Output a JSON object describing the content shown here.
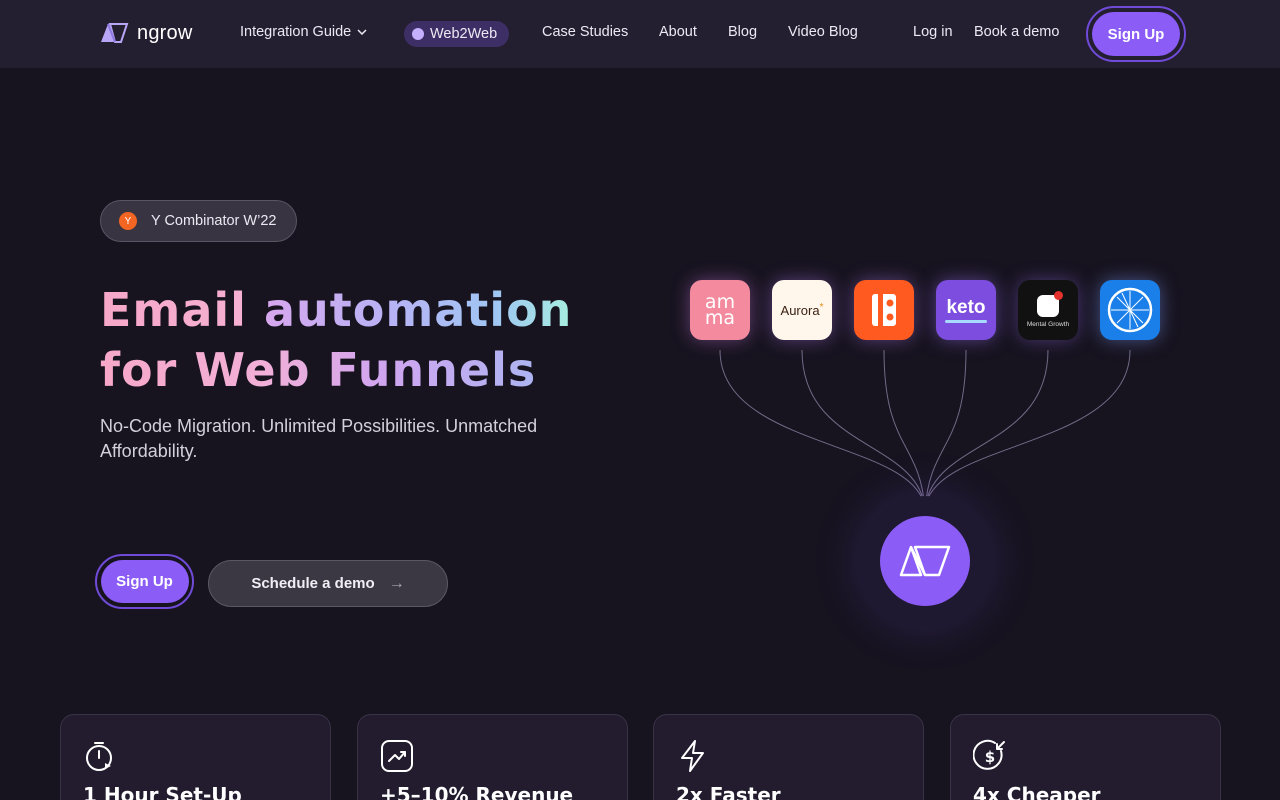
{
  "header": {
    "logo_text": "ngrow",
    "nav": [
      {
        "label": "Integration Guide"
      },
      {
        "label": "Web2Web"
      },
      {
        "label": "Case Studies"
      },
      {
        "label": "About"
      },
      {
        "label": "Blog"
      },
      {
        "label": "Video Blog"
      }
    ],
    "login_label": "Log in",
    "book_demo_label": "Book a demo",
    "signup_label": "Sign Up"
  },
  "hero": {
    "badge_icon_letter": "Y",
    "badge_text": "Y Combinator W’22",
    "title_line1_word1": "Email",
    "title_line1_word2": "automation",
    "title_line2": "for Web Funnels",
    "subtitle": "No-Code Migration. Unlimited Possibilities. Unmatched Affordability.",
    "signup_label": "Sign Up",
    "demo_label": "Schedule a demo"
  },
  "integrations": [
    {
      "name": "amma",
      "text": "am ma",
      "color": "#f38a9e"
    },
    {
      "name": "Aurora",
      "text": "Aurora",
      "color": "#fff7ec"
    },
    {
      "name": "B",
      "text": "",
      "color": "#ff5a1f"
    },
    {
      "name": "keto",
      "text": "keto",
      "color": "#7c4ddf"
    },
    {
      "name": "Mental Growth",
      "text": "Mental Growth",
      "color": "#111111"
    },
    {
      "name": "compass-app",
      "text": "",
      "color": "#1a7fe8"
    }
  ],
  "features": [
    {
      "icon": "timer-icon",
      "title": "1 Hour Set-Up"
    },
    {
      "icon": "trend-up-icon",
      "title": "+5–10% Revenue"
    },
    {
      "icon": "lightning-icon",
      "title": "2x Faster"
    },
    {
      "icon": "dollar-down-icon",
      "title": "4x Cheaper"
    }
  ],
  "colors": {
    "accent": "#8b5cf6",
    "background": "#17131f",
    "header": "#241e31"
  }
}
